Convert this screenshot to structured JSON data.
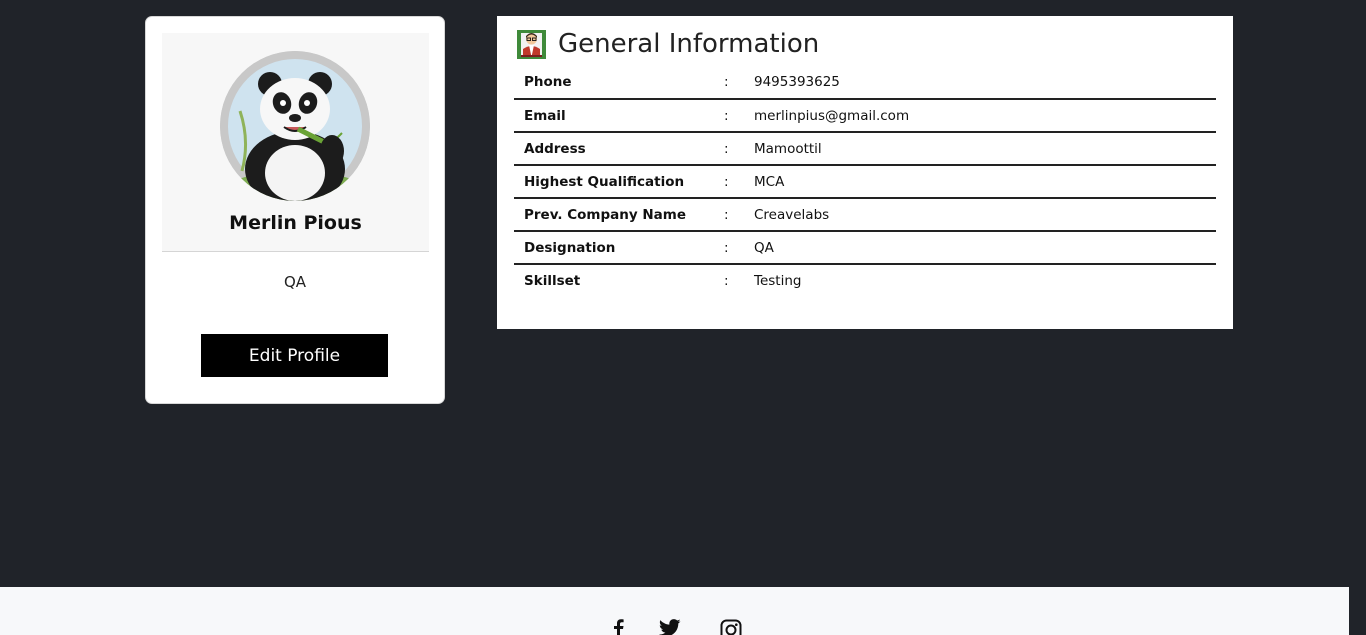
{
  "profile": {
    "name": "Merlin Pious",
    "role": "QA",
    "edit_button": "Edit Profile",
    "avatar_icon": "panda-avatar"
  },
  "general": {
    "title": "General Information",
    "title_icon": "person-icon",
    "rows": [
      {
        "label": "Phone",
        "sep": ":",
        "value": "9495393625"
      },
      {
        "label": "Email",
        "sep": ":",
        "value": "merlinpius@gmail.com"
      },
      {
        "label": "Address",
        "sep": ":",
        "value": "Mamoottil"
      },
      {
        "label": "Highest Qualification",
        "sep": ":",
        "value": "MCA"
      },
      {
        "label": "Prev. Company Name",
        "sep": ":",
        "value": "Creavelabs"
      },
      {
        "label": "Designation",
        "sep": ":",
        "value": "QA"
      },
      {
        "label": "Skillset",
        "sep": ":",
        "value": "Testing"
      }
    ]
  },
  "footer": {
    "social": [
      "facebook-icon",
      "twitter-icon",
      "instagram-icon"
    ]
  },
  "colors": {
    "background": "#202329",
    "card": "#ffffff",
    "button": "#000000",
    "footer": "#f7f8fa"
  }
}
